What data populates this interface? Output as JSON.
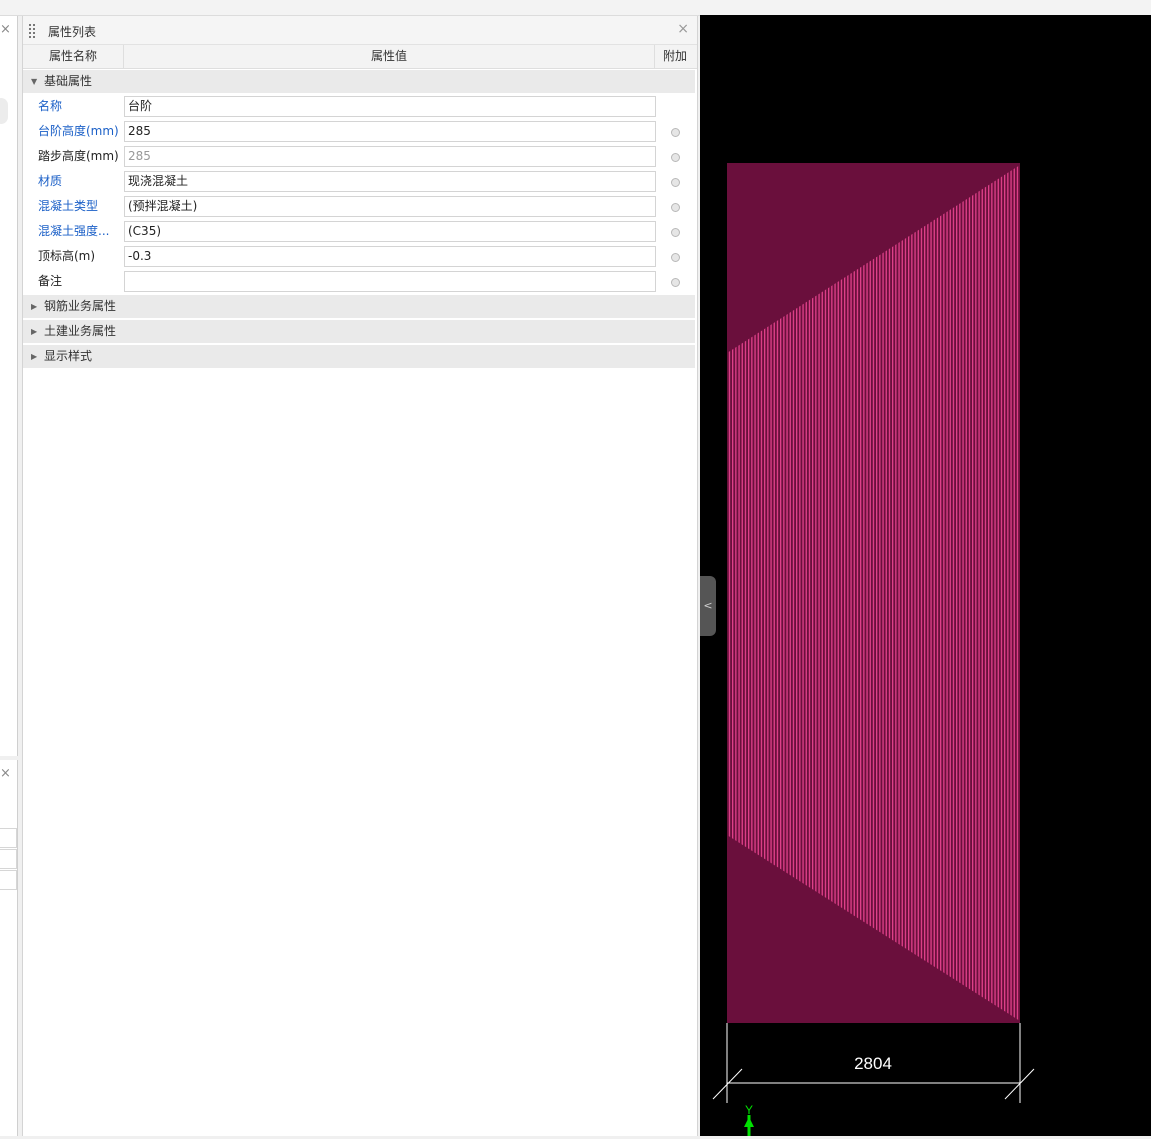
{
  "panel": {
    "title": "属性列表",
    "close_glyph": "×",
    "header": {
      "name_col": "属性名称",
      "value_col": "属性值",
      "extra_col": "附加"
    }
  },
  "groups": {
    "basic": "基础属性",
    "rebar": "钢筋业务属性",
    "civil": "土建业务属性",
    "display": "显示样式"
  },
  "properties": [
    {
      "name": "名称",
      "value": "台阶",
      "name_color": "black-blue",
      "style": "blue"
    },
    {
      "name": "台阶高度(mm)",
      "value": "285",
      "style": "blue"
    },
    {
      "name": "踏步高度(mm)",
      "value": "285",
      "style": "black",
      "value_gray": true
    },
    {
      "name": "材质",
      "value": "现浇混凝土",
      "style": "blue"
    },
    {
      "name": "混凝土类型",
      "value": "(预拌混凝土)",
      "style": "blue"
    },
    {
      "name": "混凝土强度...",
      "value": "(C35)",
      "style": "blue"
    },
    {
      "name": "顶标高(m)",
      "value": "-0.3",
      "style": "black"
    },
    {
      "name": "备注",
      "value": "",
      "style": "black"
    }
  ],
  "drawing": {
    "dimension_label": "2804",
    "axis_label": "Y",
    "colors": {
      "dark_fill": "#6a0f3c",
      "hatch": "#e0408a",
      "dimension_line": "#ffffff",
      "axis": "#00e000"
    }
  },
  "collapse_glyph": "<"
}
